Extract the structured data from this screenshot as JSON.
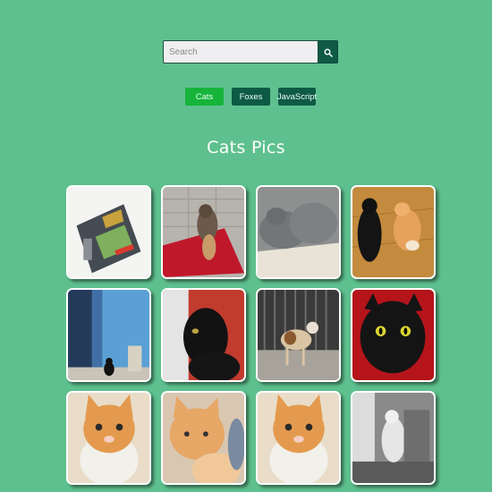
{
  "search": {
    "placeholder": "Search"
  },
  "icons": {
    "search": "search-icon"
  },
  "tabs": [
    {
      "label": "Cats",
      "active": true
    },
    {
      "label": "Foxes",
      "active": false
    },
    {
      "label": "JavaScript",
      "active": false
    }
  ],
  "page": {
    "title": "Cats Pics"
  },
  "colors": {
    "background": "#5ec08e",
    "tab_active": "#16b43a",
    "tab_inactive": "#0e5a45",
    "search_button": "#0e5a45"
  }
}
